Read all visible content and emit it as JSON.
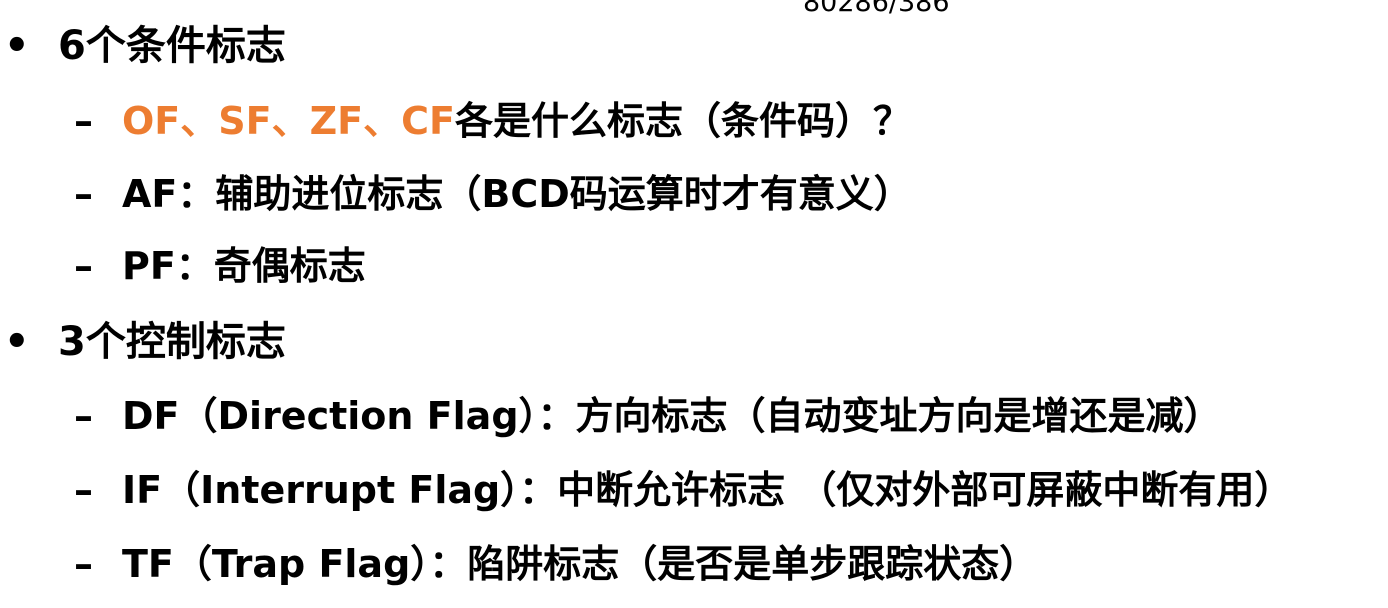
{
  "header": {
    "model_label": "80286/386"
  },
  "colors": {
    "accent": "#ED7D31",
    "text": "#000000",
    "background": "#FFFFFF"
  },
  "markers": {
    "bullet": "•",
    "dash": "–"
  },
  "sections": [
    {
      "title": "6个条件标志",
      "items": [
        {
          "highlight": "OF、SF、ZF、CF",
          "text": "各是什么标志（条件码）？"
        },
        {
          "text": "AF：辅助进位标志（BCD码运算时才有意义）"
        },
        {
          "text": "PF：奇偶标志"
        }
      ]
    },
    {
      "title": "3个控制标志",
      "items": [
        {
          "text": "DF（Direction Flag）：方向标志（自动变址方向是增还是减）"
        },
        {
          "text": "IF（Interrupt Flag）：中断允许标志 （仅对外部可屏蔽中断有用）"
        },
        {
          "text": "TF（Trap Flag）：陷阱标志（是否是单步跟踪状态）"
        }
      ]
    }
  ]
}
